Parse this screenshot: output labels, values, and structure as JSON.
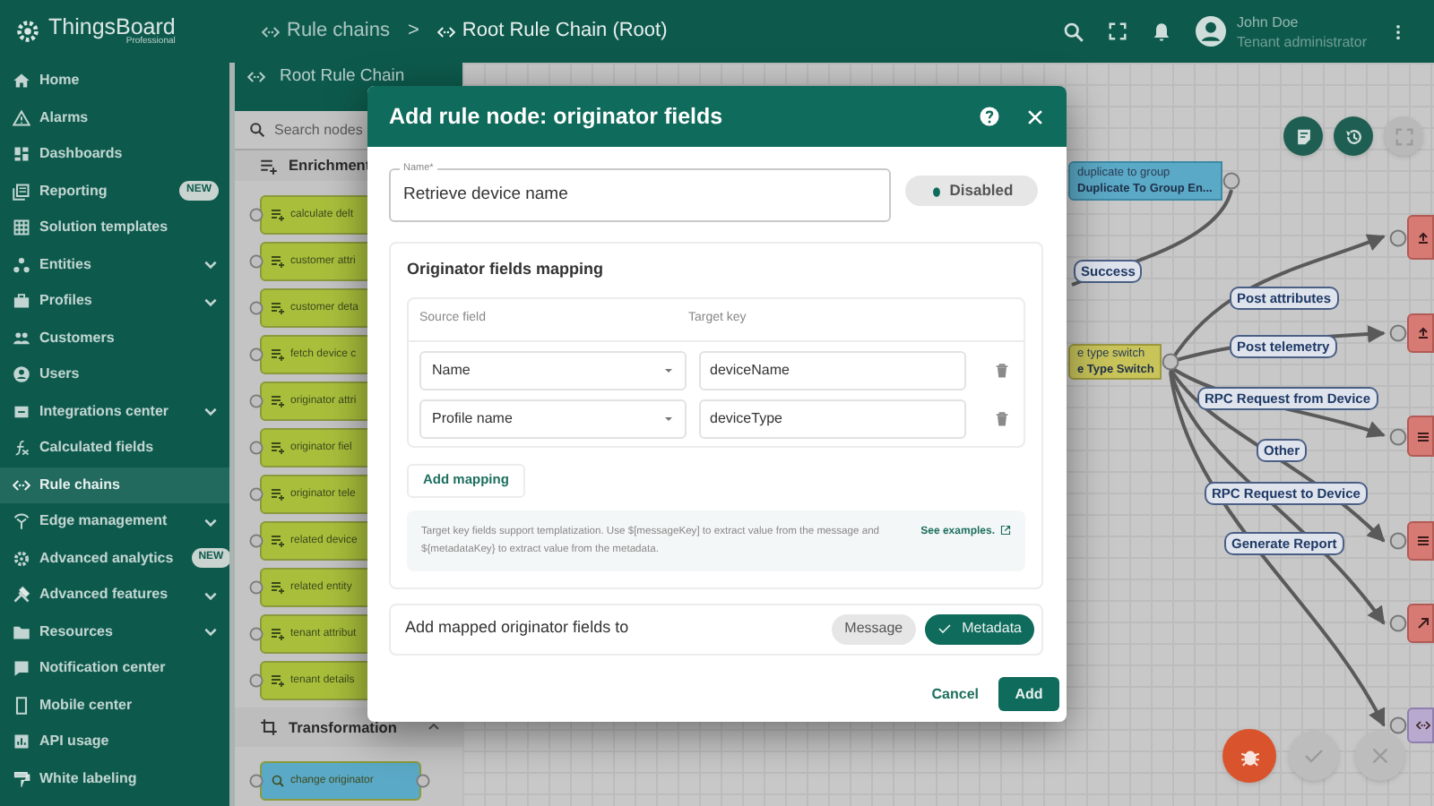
{
  "app": {
    "logo": "ThingsBoard",
    "edition": "Professional"
  },
  "breadcrumb": {
    "items": [
      {
        "label": "Rule chains"
      },
      {
        "label": "Root Rule Chain (Root)"
      }
    ],
    "separator": ">"
  },
  "user": {
    "name": "John Doe",
    "role": "Tenant administrator"
  },
  "sidebar": {
    "items": [
      {
        "label": "Home",
        "kind": "link",
        "selected": false
      },
      {
        "label": "Alarms",
        "kind": "link",
        "selected": false
      },
      {
        "label": "Dashboards",
        "kind": "link",
        "selected": false
      },
      {
        "label": "Reporting",
        "kind": "link",
        "selected": false,
        "badge": "NEW"
      },
      {
        "label": "Solution templates",
        "kind": "link",
        "selected": false
      },
      {
        "label": "Entities",
        "kind": "group",
        "selected": false
      },
      {
        "label": "Profiles",
        "kind": "group",
        "selected": false
      },
      {
        "label": "Customers",
        "kind": "link",
        "selected": false
      },
      {
        "label": "Users",
        "kind": "link",
        "selected": false
      },
      {
        "label": "Integrations center",
        "kind": "group",
        "selected": false
      },
      {
        "label": "Calculated fields",
        "kind": "link",
        "selected": false
      },
      {
        "label": "Rule chains",
        "kind": "link",
        "selected": true
      },
      {
        "label": "Edge management",
        "kind": "group",
        "selected": false
      },
      {
        "label": "Advanced analytics",
        "kind": "link",
        "selected": false,
        "badge": "NEW"
      },
      {
        "label": "Advanced features",
        "kind": "group",
        "selected": false
      },
      {
        "label": "Resources",
        "kind": "group",
        "selected": false
      },
      {
        "label": "Notification center",
        "kind": "link",
        "selected": false
      },
      {
        "label": "Mobile center",
        "kind": "link",
        "selected": false
      },
      {
        "label": "API usage",
        "kind": "link",
        "selected": false
      },
      {
        "label": "White labeling",
        "kind": "link",
        "selected": false
      }
    ]
  },
  "node_library": {
    "chain": "Root Rule Chain",
    "search": {
      "placeholder": "Search nodes"
    },
    "sections": [
      {
        "title": "Enrichment",
        "nodes": [
          "calculate delt",
          "customer attri",
          "customer deta",
          "fetch device c",
          "originator attri",
          "originator fiel",
          "originator tele",
          "related device",
          "related entity",
          "tenant attribut",
          "tenant details"
        ]
      },
      {
        "title": "Transformation",
        "nodes": [
          "change originator"
        ]
      }
    ]
  },
  "canvas": {
    "controls": [
      {
        "disabled": false
      },
      {
        "disabled": false
      },
      {
        "disabled": true
      }
    ],
    "nodes": [
      {
        "kind": "action",
        "lines": [
          "duplicate to group",
          "Duplicate To Group En..."
        ]
      },
      {
        "kind": "filter",
        "lines": [
          "e type switch",
          "e Type Switch"
        ]
      },
      {
        "kind": "upload"
      },
      {
        "kind": "upload"
      },
      {
        "kind": "list"
      },
      {
        "kind": "list"
      },
      {
        "kind": "arrow"
      },
      {
        "kind": "chain"
      }
    ],
    "links": [
      {
        "label": "Success"
      },
      {
        "label": "Post attributes"
      },
      {
        "label": "Post telemetry"
      },
      {
        "label": "RPC Request from Device"
      },
      {
        "label": "Other"
      },
      {
        "label": "RPC Request to Device"
      },
      {
        "label": "Generate Report"
      }
    ],
    "actions": [
      {
        "kind": "debug",
        "disabled": false
      },
      {
        "kind": "apply",
        "disabled": true
      },
      {
        "kind": "cancel",
        "disabled": true
      }
    ]
  },
  "dialog": {
    "title": "Add rule node: originator fields",
    "name_field": {
      "label": "Name*",
      "value": "Retrieve device name"
    },
    "debug_button": "Disabled",
    "mapping": {
      "title": "Originator fields mapping",
      "columns": [
        "Source field",
        "Target key"
      ],
      "rows": [
        {
          "source": "Name",
          "target": "deviceName"
        },
        {
          "source": "Profile name",
          "target": "deviceType"
        }
      ],
      "add_button": "Add mapping",
      "hint": "Target key fields support templatization. Use $[messageKey] to extract value from the message and ${metadataKey} to extract value from the metadata.",
      "hint_link": "See examples."
    },
    "destination": {
      "label": "Add mapped originator fields to",
      "options": [
        {
          "label": "Message",
          "selected": false
        },
        {
          "label": "Metadata",
          "selected": true
        }
      ]
    },
    "buttons": {
      "cancel": "Cancel",
      "confirm": "Add"
    }
  }
}
